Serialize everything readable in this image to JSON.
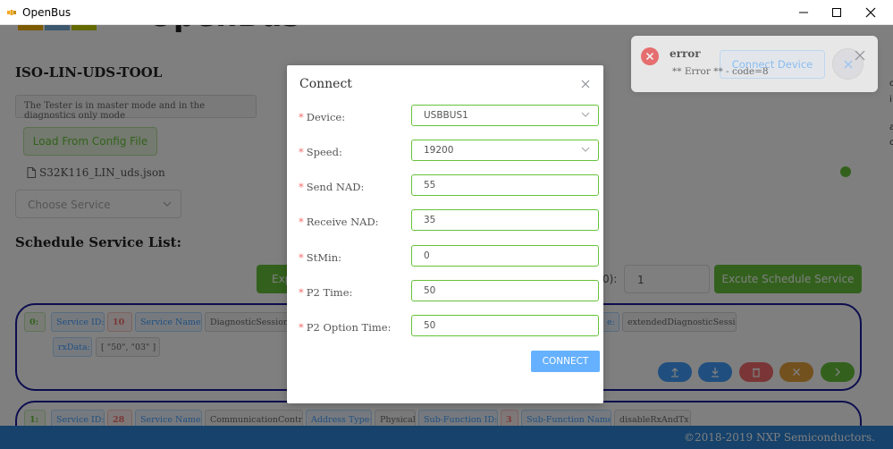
{
  "window": {
    "title": "OpenBus"
  },
  "app": {
    "logo_text": "OpenBus",
    "tool_title": "ISO-LIN-UDS-TOOL",
    "mode_text": "The Tester is in master mode and in the diagnostics only mode",
    "load_button": "Load From Config File",
    "config_file": "S32K116_LIN_uds.json",
    "choose_service_placeholder": "Choose Service",
    "schedule_title": "Schedule Service List:",
    "export_button": "Exp",
    "count_label": "0):",
    "count_value": "1",
    "excute_button": "Excute Schedule Service",
    "edge_chars": [
      "c",
      "i",
      "a",
      "c"
    ]
  },
  "services": [
    {
      "index": "0:",
      "service_id_label": "Service ID:",
      "service_id": "10",
      "service_name_label": "Service Name:",
      "service_name": "DiagnosticSessionCo",
      "hidden_label_tail": "e:",
      "sub_function_name": "extendedDiagnosticSession",
      "rxdata_label": "rxData:",
      "rxdata": "[ \"50\", \"03\" ]"
    },
    {
      "index": "1:",
      "service_id_label": "Service ID:",
      "service_id": "28",
      "service_name_label": "Service Name:",
      "service_name": "CommunicationControl",
      "address_type_label": "Address Type:",
      "address_type": "Physical",
      "sub_function_id_label": "Sub-Function ID:",
      "sub_function_id": "3",
      "sub_function_name_label": "Sub-Function Name:",
      "sub_function_name": "disableRxAndTx"
    }
  ],
  "footer": {
    "copyright": "©2018-2019 NXP Semiconductors."
  },
  "dialog": {
    "title": "Connect",
    "fields": [
      {
        "label": "Device:",
        "value": "USBBUS1",
        "type": "select"
      },
      {
        "label": "Speed:",
        "value": "19200",
        "type": "select"
      },
      {
        "label": "Send NAD:",
        "value": "55",
        "type": "input"
      },
      {
        "label": "Receive NAD:",
        "value": "35",
        "type": "input"
      },
      {
        "label": "StMin:",
        "value": "0",
        "type": "input"
      },
      {
        "label": "P2 Time:",
        "value": "50",
        "type": "input"
      },
      {
        "label": "P2 Option Time:",
        "value": "50",
        "type": "input"
      }
    ],
    "connect_button": "CONNECT"
  },
  "notification": {
    "title": "error",
    "message": "** Error ** - code=8",
    "ghost_button": "Connect Device"
  },
  "colors": {
    "accent_blue": "#409eff",
    "success_green": "#67c23a",
    "danger_red": "#f56c6c",
    "card_border": "#1a1aa0",
    "footer_blue": "#2d84d6"
  }
}
